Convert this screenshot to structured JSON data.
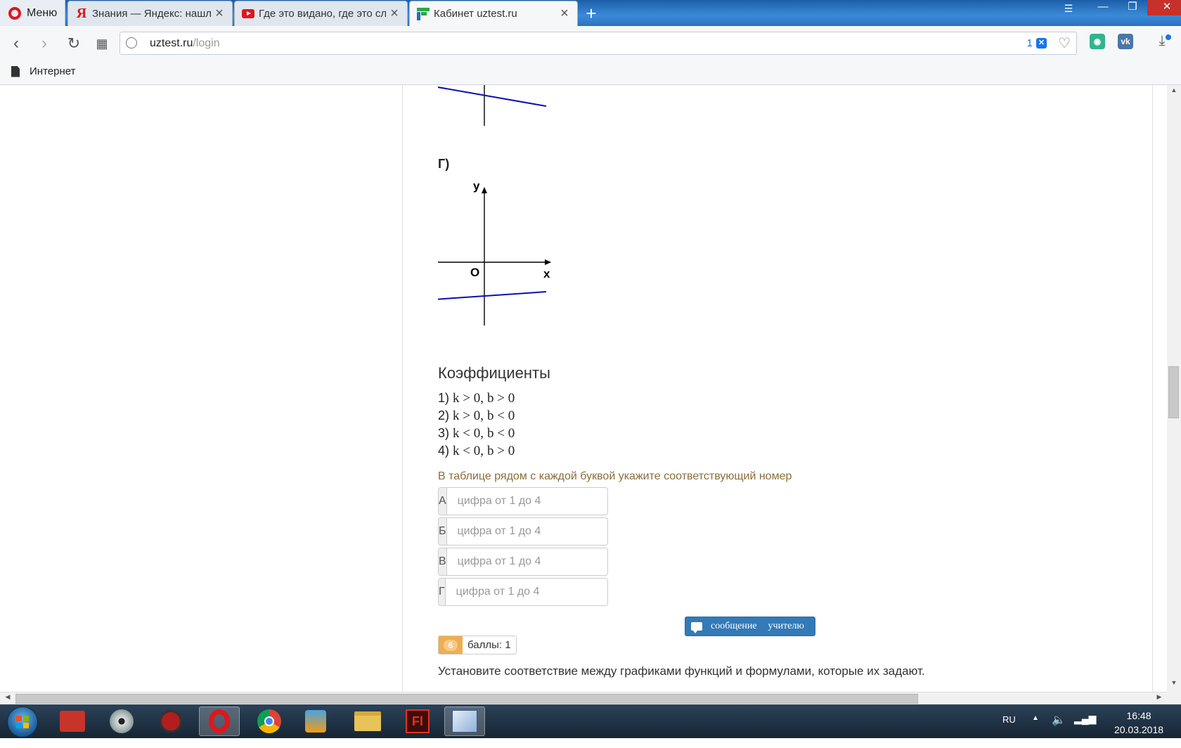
{
  "browser": {
    "menu_label": "Меню",
    "tabs": [
      {
        "title": "Знания — Яндекс: нашло",
        "icon": "yandex-icon"
      },
      {
        "title": "Где это видано, где это сл",
        "icon": "youtube-icon"
      },
      {
        "title": "Кабинет uztest.ru",
        "icon": "uztest-icon",
        "active": true
      }
    ],
    "new_tab_label": "+",
    "url_host": "uztest.ru",
    "url_path": "/login",
    "adblock_count": "1",
    "bookmark_label": "Интернет"
  },
  "question": {
    "graph_letter": "Г)",
    "axis_y": "y",
    "axis_x": "x",
    "origin": "O",
    "coef_title": "Коэффициенты",
    "coefficients": [
      {
        "num": "1)",
        "k": "k > 0,",
        "b": "b > 0"
      },
      {
        "num": "2)",
        "k": "k > 0,",
        "b": "b < 0"
      },
      {
        "num": "3)",
        "k": "k < 0,",
        "b": "b < 0"
      },
      {
        "num": "4)",
        "k": "k < 0,",
        "b": "b > 0"
      }
    ],
    "instruction": "В таблице рядом с каждой буквой укажите соответствующий номер",
    "answers": [
      {
        "letter": "А",
        "placeholder": "цифра от 1 до 4",
        "value": ""
      },
      {
        "letter": "Б",
        "placeholder": "цифра от 1 до 4",
        "value": ""
      },
      {
        "letter": "В",
        "placeholder": "цифра от 1 до 4",
        "value": ""
      },
      {
        "letter": "Г",
        "placeholder": "цифра от 1 до 4",
        "value": ""
      }
    ],
    "message_button": {
      "word1": "сообщение",
      "word2": "учителю"
    },
    "next_number": "6",
    "next_points": "баллы: 1",
    "next_text": "Установите соответствие между графиками функций и формулами, которые их задают."
  },
  "taskbar": {
    "language": "RU",
    "time": "16:48",
    "date": "20.03.2018",
    "apps": [
      "store-app-icon",
      "dvd-app-icon",
      "game-app-icon",
      "opera-app-icon",
      "chrome-app-icon",
      "media-player-app-icon",
      "explorer-app-icon",
      "flash-app-icon",
      "paint-app-icon"
    ]
  },
  "colors": {
    "graph_line": "#0a10b0",
    "accent_button": "#337ab7",
    "score_badge": "#f0ad4e",
    "instruction_text": "#8a6d3b"
  }
}
